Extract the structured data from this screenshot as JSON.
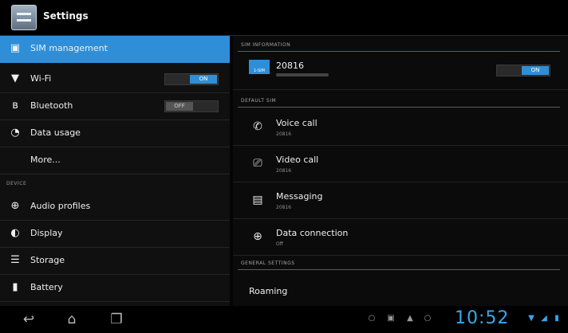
{
  "app": {
    "title": "Settings",
    "icon": "settings-app-icon"
  },
  "left_panel": {
    "items": [
      {
        "label": "SIM management",
        "icon": "sim-card-icon",
        "selected": true
      },
      {
        "label": "Wi-Fi",
        "icon": "wifi-icon",
        "toggle": "ON"
      },
      {
        "label": "Bluetooth",
        "icon": "bluetooth-icon",
        "toggle": "OFF"
      },
      {
        "label": "Data usage",
        "icon": "data-usage-icon"
      },
      {
        "label": "More..."
      },
      {
        "label": "Audio profiles",
        "icon": "audio-profiles-icon"
      },
      {
        "label": "Display",
        "icon": "display-icon"
      },
      {
        "label": "Storage",
        "icon": "storage-icon"
      },
      {
        "label": "Battery",
        "icon": "battery-icon"
      }
    ],
    "device_section": "DEVICE"
  },
  "right_panel": {
    "sim_information_header": "SIM INFORMATION",
    "sim": {
      "name": "20816",
      "badge": "1-SIM",
      "toggle": "ON"
    },
    "default_sim_header": "DEFAULT SIM",
    "default_sim_items": [
      {
        "label": "Voice call",
        "sub": "20816",
        "icon": "phone-icon"
      },
      {
        "label": "Video call",
        "sub": "20816",
        "icon": "video-call-icon"
      },
      {
        "label": "Messaging",
        "sub": "20816",
        "icon": "messaging-icon"
      },
      {
        "label": "Data connection",
        "sub": "Off",
        "icon": "globe-icon"
      }
    ],
    "general_settings_header": "GENERAL SETTINGS",
    "roaming_label": "Roaming"
  },
  "navbar": {
    "clock": "10:52",
    "accent": "#39a7ee"
  }
}
